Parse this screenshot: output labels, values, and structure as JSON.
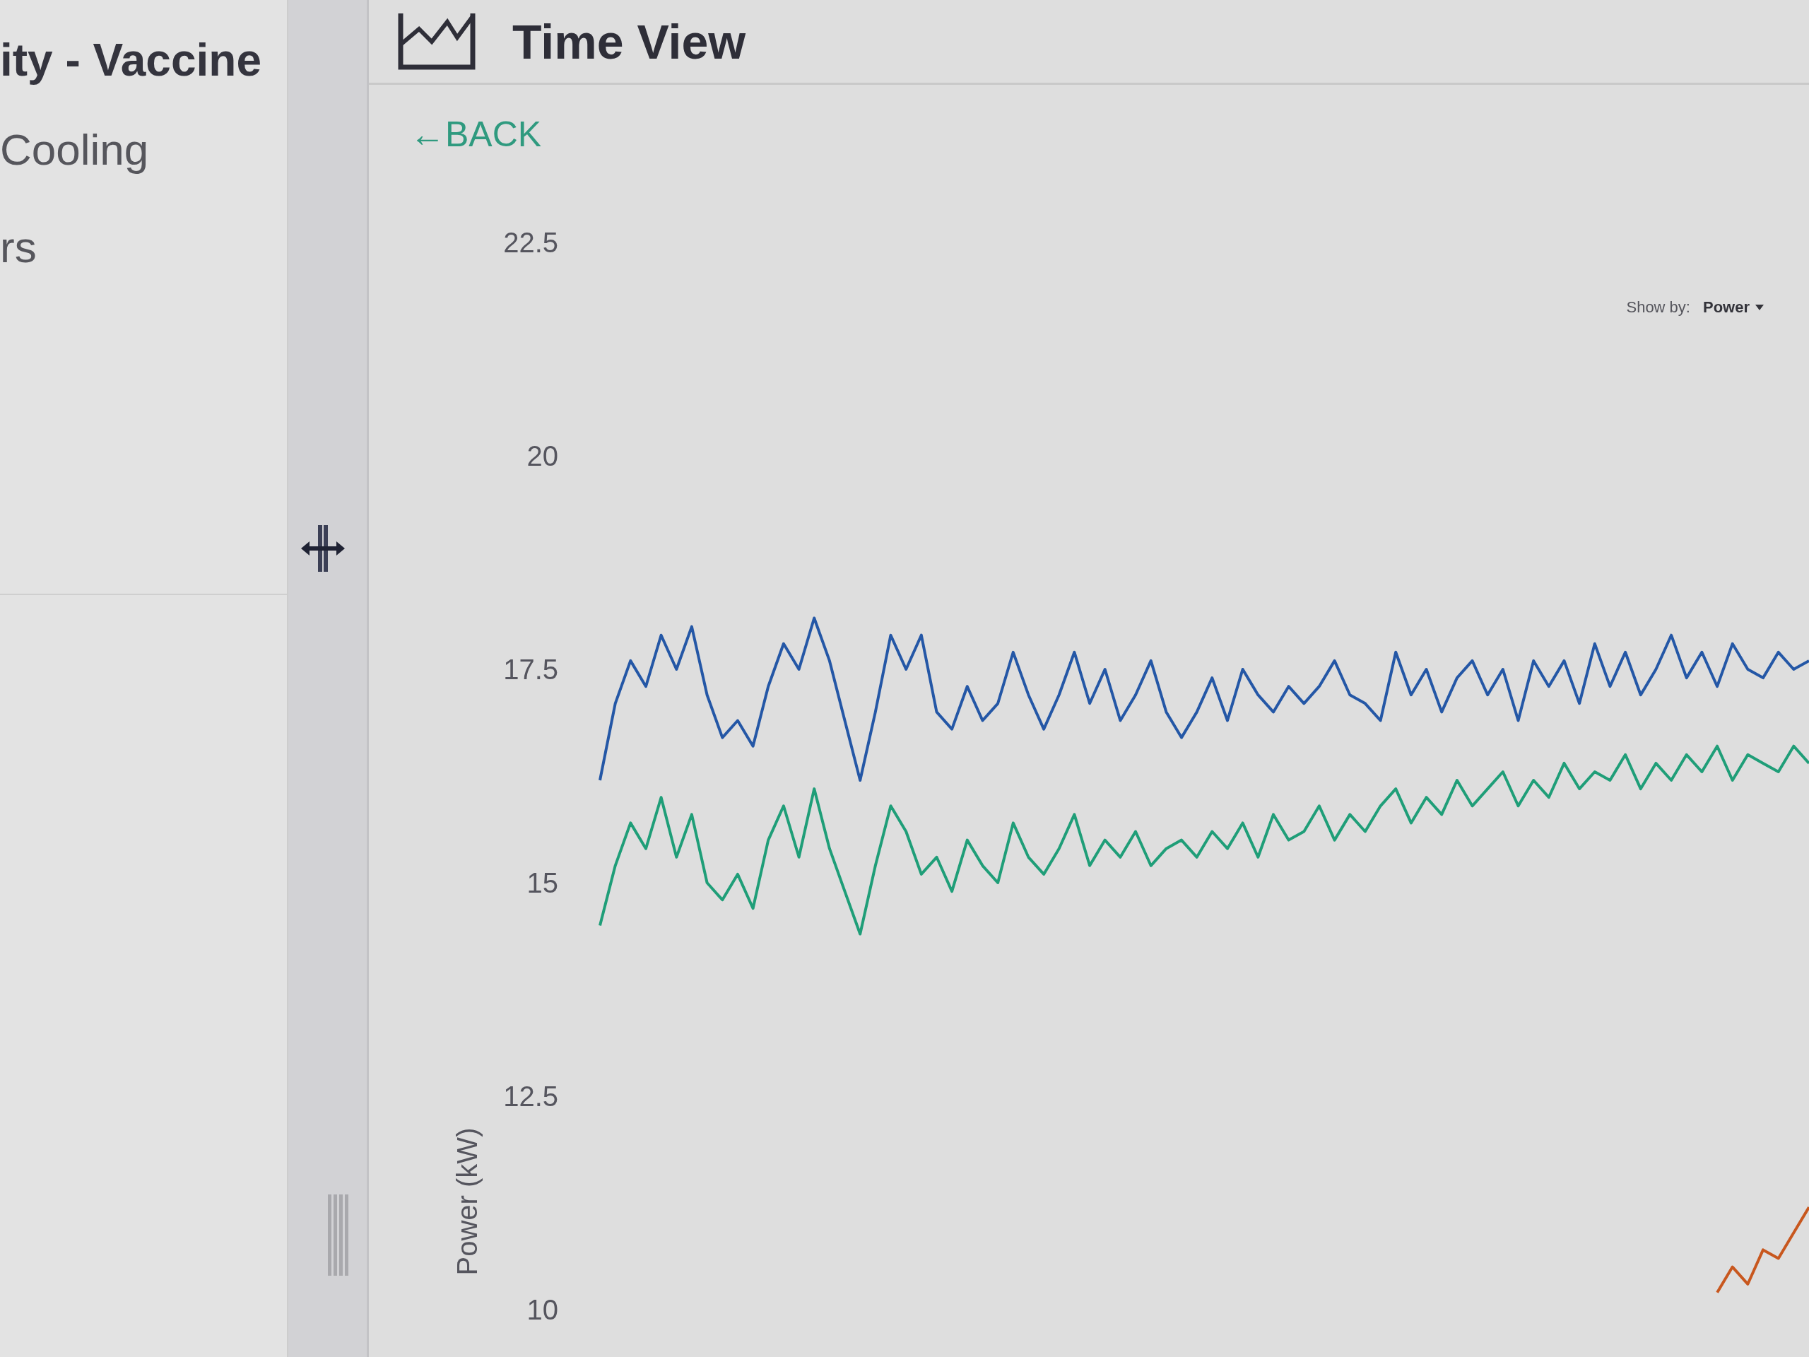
{
  "sidebar": {
    "title": "ity - Vaccine",
    "items": [
      {
        "label": "Cooling"
      },
      {
        "label": "rs"
      }
    ]
  },
  "panel": {
    "title": "Time View",
    "back_link": "←BACK",
    "show_by": {
      "label": "Show by:",
      "value": "Power"
    },
    "chart_data": {
      "type": "line",
      "ylabel": "Power (kW)",
      "ylim": [
        10,
        22.5
      ],
      "yticks": [
        10,
        12.5,
        15,
        17.5,
        20,
        22.5
      ],
      "series": [
        {
          "color": "#2457a6",
          "values": [
            16.2,
            17.1,
            17.6,
            17.3,
            17.9,
            17.5,
            18.0,
            17.2,
            16.7,
            16.9,
            16.6,
            17.3,
            17.8,
            17.5,
            18.1,
            17.6,
            16.9,
            16.2,
            17.0,
            17.9,
            17.5,
            17.9,
            17.0,
            16.8,
            17.3,
            16.9,
            17.1,
            17.7,
            17.2,
            16.8,
            17.2,
            17.7,
            17.1,
            17.5,
            16.9,
            17.2,
            17.6,
            17.0,
            16.7,
            17.0,
            17.4,
            16.9,
            17.5,
            17.2,
            17.0,
            17.3,
            17.1,
            17.3,
            17.6,
            17.2,
            17.1,
            16.9,
            17.7,
            17.2,
            17.5,
            17.0,
            17.4,
            17.6,
            17.2,
            17.5,
            16.9,
            17.6,
            17.3,
            17.6,
            17.1,
            17.8,
            17.3,
            17.7,
            17.2,
            17.5,
            17.9,
            17.4,
            17.7,
            17.3,
            17.8,
            17.5,
            17.4,
            17.7,
            17.5,
            17.6
          ]
        },
        {
          "color": "#1f9e78",
          "values": [
            14.5,
            15.2,
            15.7,
            15.4,
            16.0,
            15.3,
            15.8,
            15.0,
            14.8,
            15.1,
            14.7,
            15.5,
            15.9,
            15.3,
            16.1,
            15.4,
            14.9,
            14.4,
            15.2,
            15.9,
            15.6,
            15.1,
            15.3,
            14.9,
            15.5,
            15.2,
            15.0,
            15.7,
            15.3,
            15.1,
            15.4,
            15.8,
            15.2,
            15.5,
            15.3,
            15.6,
            15.2,
            15.4,
            15.5,
            15.3,
            15.6,
            15.4,
            15.7,
            15.3,
            15.8,
            15.5,
            15.6,
            15.9,
            15.5,
            15.8,
            15.6,
            15.9,
            16.1,
            15.7,
            16.0,
            15.8,
            16.2,
            15.9,
            16.1,
            16.3,
            15.9,
            16.2,
            16.0,
            16.4,
            16.1,
            16.3,
            16.2,
            16.5,
            16.1,
            16.4,
            16.2,
            16.5,
            16.3,
            16.6,
            16.2,
            16.5,
            16.4,
            16.3,
            16.6,
            16.4
          ]
        },
        {
          "color": "#c8571e",
          "values": [
            null,
            null,
            null,
            null,
            null,
            null,
            null,
            null,
            null,
            null,
            null,
            null,
            null,
            null,
            null,
            null,
            null,
            null,
            null,
            null,
            null,
            null,
            null,
            null,
            null,
            null,
            null,
            null,
            null,
            null,
            null,
            null,
            null,
            null,
            null,
            null,
            null,
            null,
            null,
            null,
            null,
            null,
            null,
            null,
            null,
            null,
            null,
            null,
            null,
            null,
            null,
            null,
            null,
            null,
            null,
            null,
            null,
            null,
            null,
            null,
            null,
            null,
            null,
            null,
            null,
            null,
            null,
            null,
            null,
            null,
            null,
            null,
            null,
            10.2,
            10.5,
            10.3,
            10.7,
            10.6,
            10.9,
            11.2
          ]
        }
      ]
    }
  }
}
